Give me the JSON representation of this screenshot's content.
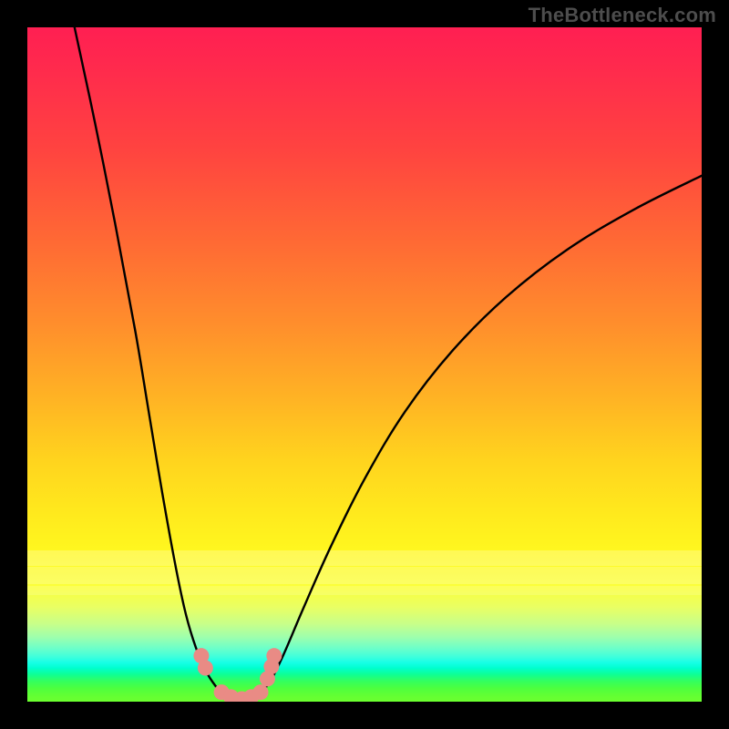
{
  "watermark": "TheBottleneck.com",
  "chart_data": {
    "type": "line",
    "title": "",
    "xlabel": "",
    "ylabel": "",
    "xlim": [
      0,
      100
    ],
    "ylim": [
      0,
      100
    ],
    "grid": false,
    "series": [
      {
        "name": "bottleneck-left",
        "x": [
          7,
          10,
          13,
          16,
          18,
          20,
          22,
          23.5,
          25,
          26.5,
          28,
          29
        ],
        "values": [
          100,
          86,
          71,
          55,
          43,
          31,
          20,
          13,
          8,
          4.5,
          2.2,
          1.2
        ]
      },
      {
        "name": "bottleneck-right",
        "x": [
          34.5,
          36,
          38,
          41,
          45,
          50,
          56,
          63,
          71,
          80,
          90,
          100
        ],
        "values": [
          1.2,
          3,
          7,
          14,
          23,
          33,
          43,
          52,
          60,
          67,
          73,
          78
        ]
      }
    ],
    "floor_segment": {
      "name": "optimal-range",
      "x": [
        29,
        30.5,
        32,
        33,
        34.5
      ],
      "values": [
        1.2,
        0.5,
        0.3,
        0.5,
        1.2
      ]
    },
    "markers": {
      "color": "#e98b85",
      "points": [
        {
          "x": 25.8,
          "y": 6.8
        },
        {
          "x": 26.4,
          "y": 5.0
        },
        {
          "x": 28.8,
          "y": 1.4
        },
        {
          "x": 30.2,
          "y": 0.7
        },
        {
          "x": 31.8,
          "y": 0.4
        },
        {
          "x": 33.2,
          "y": 0.7
        },
        {
          "x": 34.6,
          "y": 1.4
        },
        {
          "x": 35.6,
          "y": 3.4
        },
        {
          "x": 36.2,
          "y": 5.2
        },
        {
          "x": 36.6,
          "y": 6.8
        }
      ]
    },
    "background": {
      "type": "vertical-gradient",
      "stops": [
        {
          "pos": 0.0,
          "color": "#ff1f52"
        },
        {
          "pos": 0.32,
          "color": "#ff6a34"
        },
        {
          "pos": 0.64,
          "color": "#ffd31e"
        },
        {
          "pos": 0.83,
          "color": "#fbff3b"
        },
        {
          "pos": 0.95,
          "color": "#00ffcf"
        },
        {
          "pos": 1.0,
          "color": "#6cff2f"
        }
      ]
    }
  }
}
